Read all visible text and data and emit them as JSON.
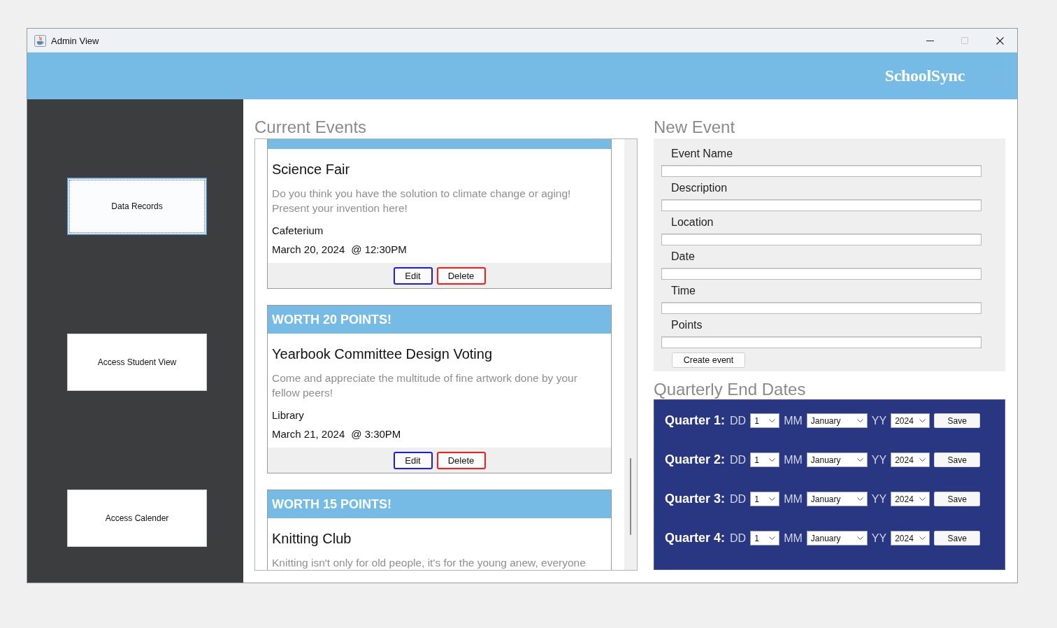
{
  "window": {
    "title": "Admin View",
    "maximize_disabled": true
  },
  "header": {
    "logo": "SchoolSync"
  },
  "sidebar": {
    "buttons": [
      {
        "label": "Data Records",
        "selected": true
      },
      {
        "label": "Access Student View",
        "selected": false
      },
      {
        "label": "Access Calender",
        "selected": false
      }
    ]
  },
  "current_events": {
    "title": "Current Events",
    "events": [
      {
        "kind": "clipped_top",
        "title": "Science Fair",
        "description": "Do you think you have the solution to climate change or aging! Present your invention here!",
        "location": "Cafeterium",
        "date": "March 20, 2024",
        "time": "@ 12:30PM",
        "buttons": [
          {
            "label": "Edit",
            "kind": "edit"
          },
          {
            "label": "Delete",
            "kind": "delete"
          }
        ]
      },
      {
        "kind": "full",
        "banner": "WORTH 20 POINTS!",
        "title": "Yearbook Committee Design Voting",
        "description": "Come and appreciate the multitude of fine artwork done by your fellow peers!",
        "location": "Library",
        "date": "March 21, 2024",
        "time": "@ 3:30PM",
        "buttons": [
          {
            "label": "Edit",
            "kind": "edit"
          },
          {
            "label": "Delete",
            "kind": "delete"
          }
        ]
      },
      {
        "kind": "clipped_bottom",
        "banner": "WORTH 15 POINTS!",
        "title": "Knitting Club",
        "description": "Knitting isn't only for old people, it's for the young anew, everyone"
      }
    ]
  },
  "new_event": {
    "title": "New Event",
    "fields": [
      {
        "label": "Event Name"
      },
      {
        "label": "Description"
      },
      {
        "label": "Location"
      },
      {
        "label": "Date"
      },
      {
        "label": "Time"
      },
      {
        "label": "Points"
      }
    ],
    "submit": "Create event"
  },
  "quarterly_end_dates": {
    "title": "Quarterly End Dates",
    "quarters": [
      {
        "label": "Quarter 1:",
        "day_label": "DD",
        "day": "1",
        "month_label": "MM",
        "month": "January",
        "year_label": "YY",
        "year": "2024",
        "save": "Save"
      },
      {
        "label": "Quarter 2:",
        "day_label": "DD",
        "day": "1",
        "month_label": "MM",
        "month": "January",
        "year_label": "YY",
        "year": "2024",
        "save": "Save"
      },
      {
        "label": "Quarter 3:",
        "day_label": "DD",
        "day": "1",
        "month_label": "MM",
        "month": "January",
        "year_label": "YY",
        "year": "2024",
        "save": "Save"
      },
      {
        "label": "Quarter 4:",
        "day_label": "DD",
        "day": "1",
        "month_label": "MM",
        "month": "January",
        "year_label": "YY",
        "year": "2024",
        "save": "Save"
      }
    ]
  }
}
